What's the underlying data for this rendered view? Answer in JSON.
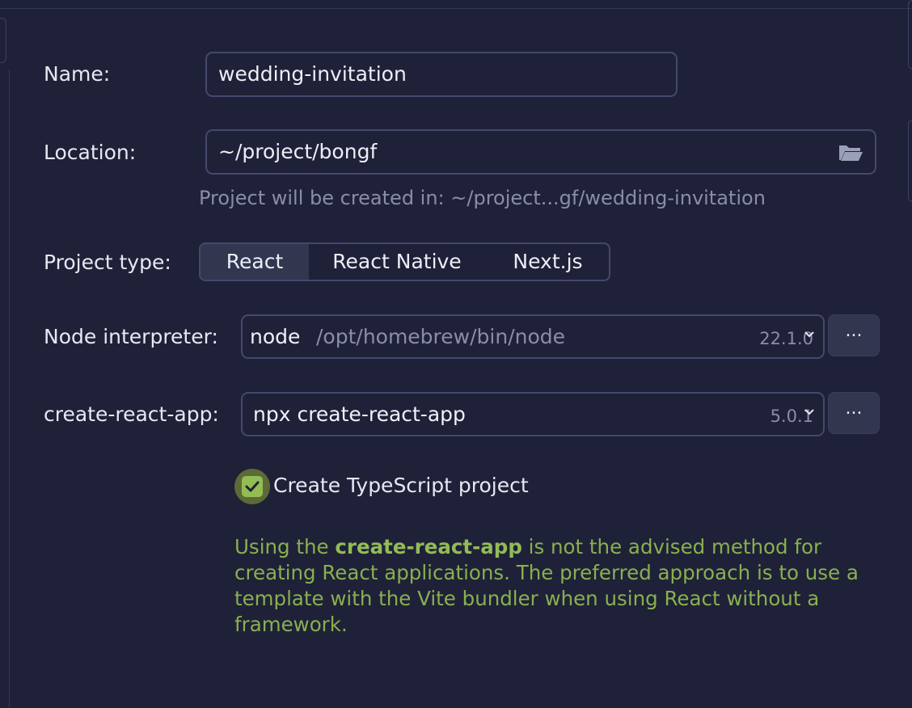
{
  "name": {
    "label": "Name:",
    "value": "wedding-invitation"
  },
  "location": {
    "label": "Location:",
    "value": "~/project/bongf",
    "icon": "folder-open-icon",
    "hint": "Project will be created in: ~/project...gf/wedding-invitation"
  },
  "project_type": {
    "label": "Project type:",
    "options": [
      "React",
      "React Native",
      "Next.js"
    ],
    "selected": "React"
  },
  "node_interpreter": {
    "label": "Node interpreter:",
    "kind": "node",
    "path": "/opt/homebrew/bin/node",
    "version": "22.1.0",
    "browse_label": "..."
  },
  "create_react_app": {
    "label": "create-react-app:",
    "value": "npx create-react-app",
    "version": "5.0.1",
    "browse_label": "..."
  },
  "typescript": {
    "label": "Create TypeScript project",
    "checked": true
  },
  "warning": {
    "prefix": "Using the ",
    "emphasis": "create-react-app",
    "suffix": " is not the advised method for creating React applications. The preferred approach is to use a template with the Vite bundler when using React without a framework."
  },
  "colors": {
    "background": "#1f2138",
    "border": "#45486b",
    "selected_segment": "#33364f",
    "hint_text": "#8a8da6",
    "warning_text": "#88b04f",
    "checkbox": "#93bd53"
  }
}
